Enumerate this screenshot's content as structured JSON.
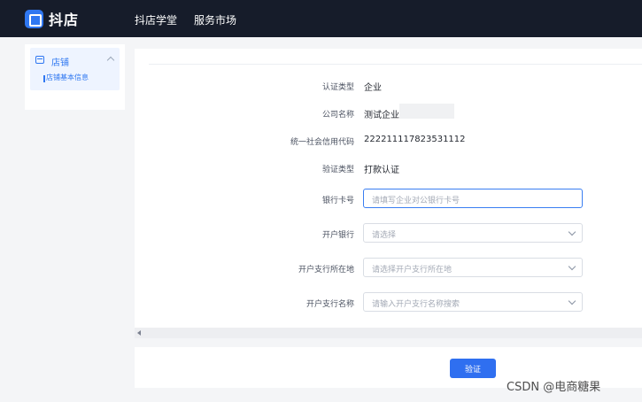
{
  "header": {
    "brand": "抖店",
    "nav": [
      "抖店学堂",
      "服务市场"
    ]
  },
  "sidebar": {
    "group_label": "店铺",
    "items": [
      {
        "label": "店铺基本信息",
        "active": true
      }
    ]
  },
  "form": {
    "cert_type_label": "认证类型",
    "cert_type_value": "企业",
    "company_label": "公司名称",
    "company_value": "测试企业",
    "credit_code_label": "统一社会信用代码",
    "credit_code_value": "222211117823531112",
    "verify_type_label": "验证类型",
    "verify_type_value": "打款认证",
    "bank_card_label": "银行卡号",
    "bank_card_placeholder": "请填写企业对公银行卡号",
    "bank_label": "开户银行",
    "bank_placeholder": "请选择",
    "branch_location_label": "开户支行所在地",
    "branch_location_placeholder": "请选择开户支行所在地",
    "branch_name_label": "开户支行名称",
    "branch_name_placeholder": "请输入开户支行名称搜索"
  },
  "actions": {
    "verify_label": "验证"
  },
  "watermark": "CSDN @电商糖果",
  "colors": {
    "topbar": "#161c2a",
    "accent": "#2f6ff0",
    "sidebar_active_bg": "#eef4ff"
  },
  "icons": {
    "logo": "doudian-logo-icon",
    "store": "store-icon",
    "collapse": "chevron-up-icon",
    "dropdown": "chevron-down-icon",
    "scroll_left": "arrow-left-icon"
  }
}
